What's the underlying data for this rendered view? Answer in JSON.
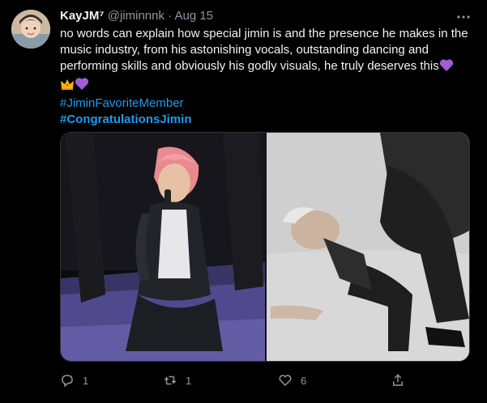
{
  "tweet": {
    "display_name": "KayJM⁷",
    "handle": "@jiminnnk",
    "separator": "·",
    "date": "Aug 15",
    "text": "no words can explain how special jimin is and the presence he makes in the music industry, from his astonishing vocals, outstanding dancing and performing skills and obviously his godly visuals, he truly deserves this",
    "hashtags": [
      "#JiminFavoriteMember",
      "#CongratulationsJimin"
    ],
    "emojis": [
      "purple-heart",
      "crown",
      "purple-heart"
    ],
    "actions": {
      "reply_count": "1",
      "retweet_count": "1",
      "like_count": "6"
    }
  },
  "colors": {
    "background": "#000000",
    "text": "#f3f3f3",
    "muted": "#8b98a5",
    "link": "#1d9bf0",
    "purple_heart": "#a35bd8",
    "crown": "#f5b400"
  }
}
